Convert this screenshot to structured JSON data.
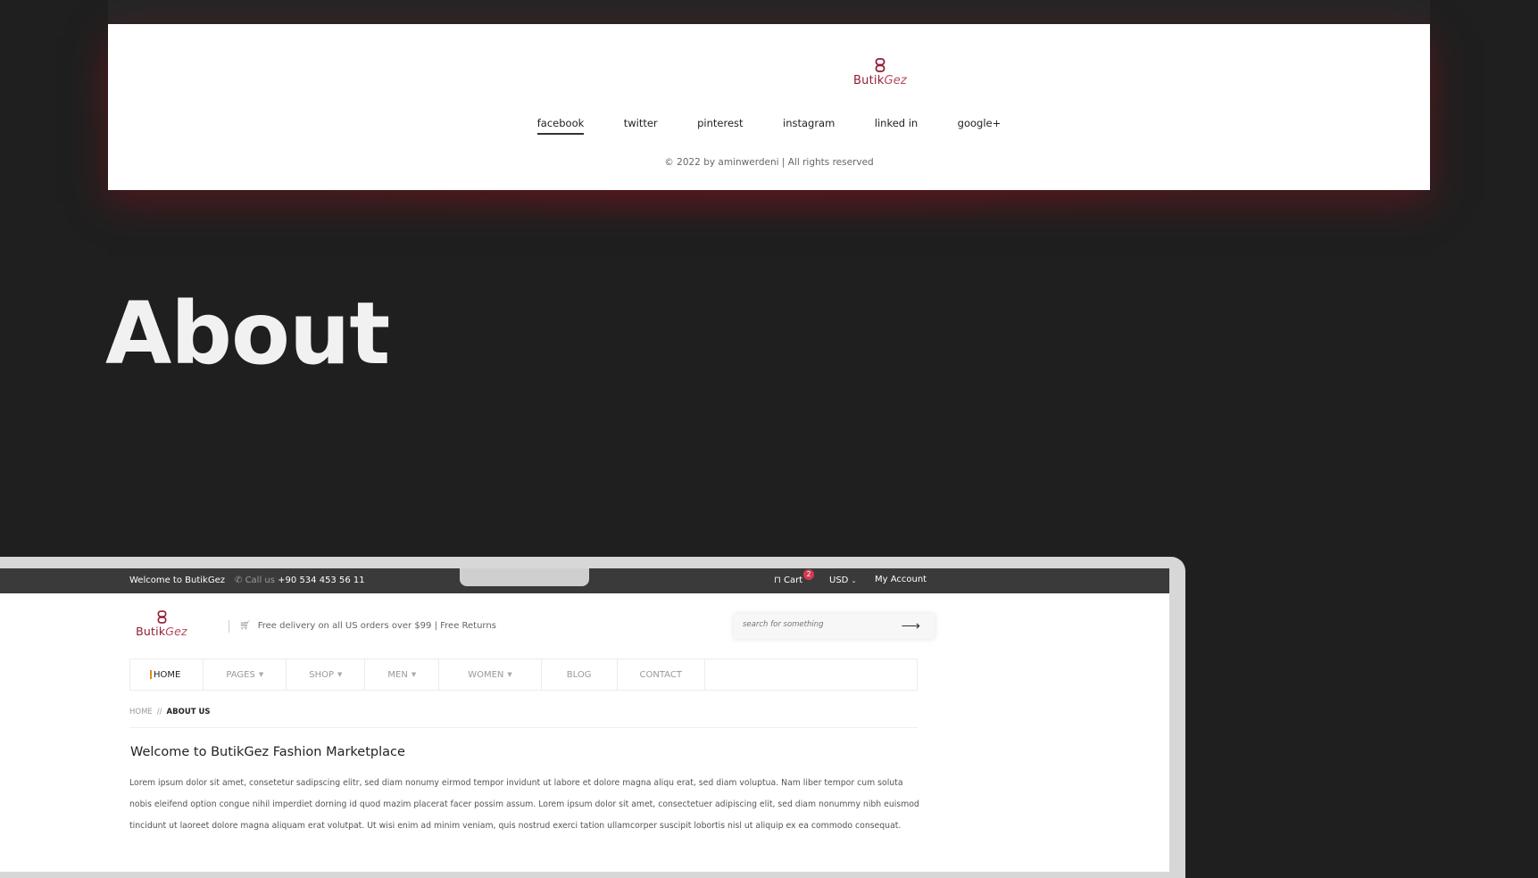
{
  "footer": {
    "logo": {
      "brand": "Butik",
      "brand_accent": "Gez"
    },
    "social_links": [
      {
        "label": "facebook",
        "active": true
      },
      {
        "label": "twitter",
        "active": false
      },
      {
        "label": "pinterest",
        "active": false
      },
      {
        "label": "instagram",
        "active": false
      },
      {
        "label": "linked in",
        "active": false
      },
      {
        "label": "google+",
        "active": false
      }
    ],
    "copyright": "© 2022 by aminwerdeni | All rights reserved"
  },
  "section_heading": "About",
  "site": {
    "topbar": {
      "welcome": "Welcome to ButikGez",
      "phone_label": "Call us",
      "phone_number": "+90 534 453 56 11",
      "cart_label": "Cart",
      "cart_count": "2",
      "currency": "USD",
      "account": "My Account"
    },
    "logo": {
      "brand": "Butik",
      "brand_accent": "Gez"
    },
    "delivery_text": "Free delivery on all US orders over $99 | Free Returns",
    "search_placeholder": "search for something",
    "nav": [
      {
        "label": "HOME",
        "dropdown": false
      },
      {
        "label": "PAGES",
        "dropdown": true
      },
      {
        "label": "SHOP",
        "dropdown": true
      },
      {
        "label": "MEN",
        "dropdown": true
      },
      {
        "label": "WOMEN",
        "dropdown": true
      },
      {
        "label": "BLOG",
        "dropdown": false
      },
      {
        "label": "CONTACT",
        "dropdown": false
      }
    ],
    "breadcrumb": {
      "home": "HOME",
      "separator": "//",
      "current": "ABOUT US"
    },
    "content_title": "Welcome to ButikGez Fashion Marketplace",
    "content_text": "Lorem ipsum dolor sit amet, consetetur sadipscing elitr, sed diam nonumy eirmod tempor invidunt ut labore et dolore magna aliqu erat, sed diam voluptua. Nam liber tempor cum soluta nobis eleifend option congue nihil imperdiet dorning id quod mazim placerat facer possim assum. Lorem ipsum dolor sit amet, consectetuer adipiscing elit, sed diam nonummy nibh euismod tincidunt ut laoreet dolore magna aliquam erat volutpat. Ut wisi enim ad minim veniam, quis nostrud exerci tation ullamcorper suscipit lobortis nisl ut aliquip ex ea commodo consequat."
  },
  "colors": {
    "brand": "#8e1f33",
    "background": "#1f1f1f",
    "badge": "#d23a52",
    "nav_active_marker": "#e0891f"
  }
}
